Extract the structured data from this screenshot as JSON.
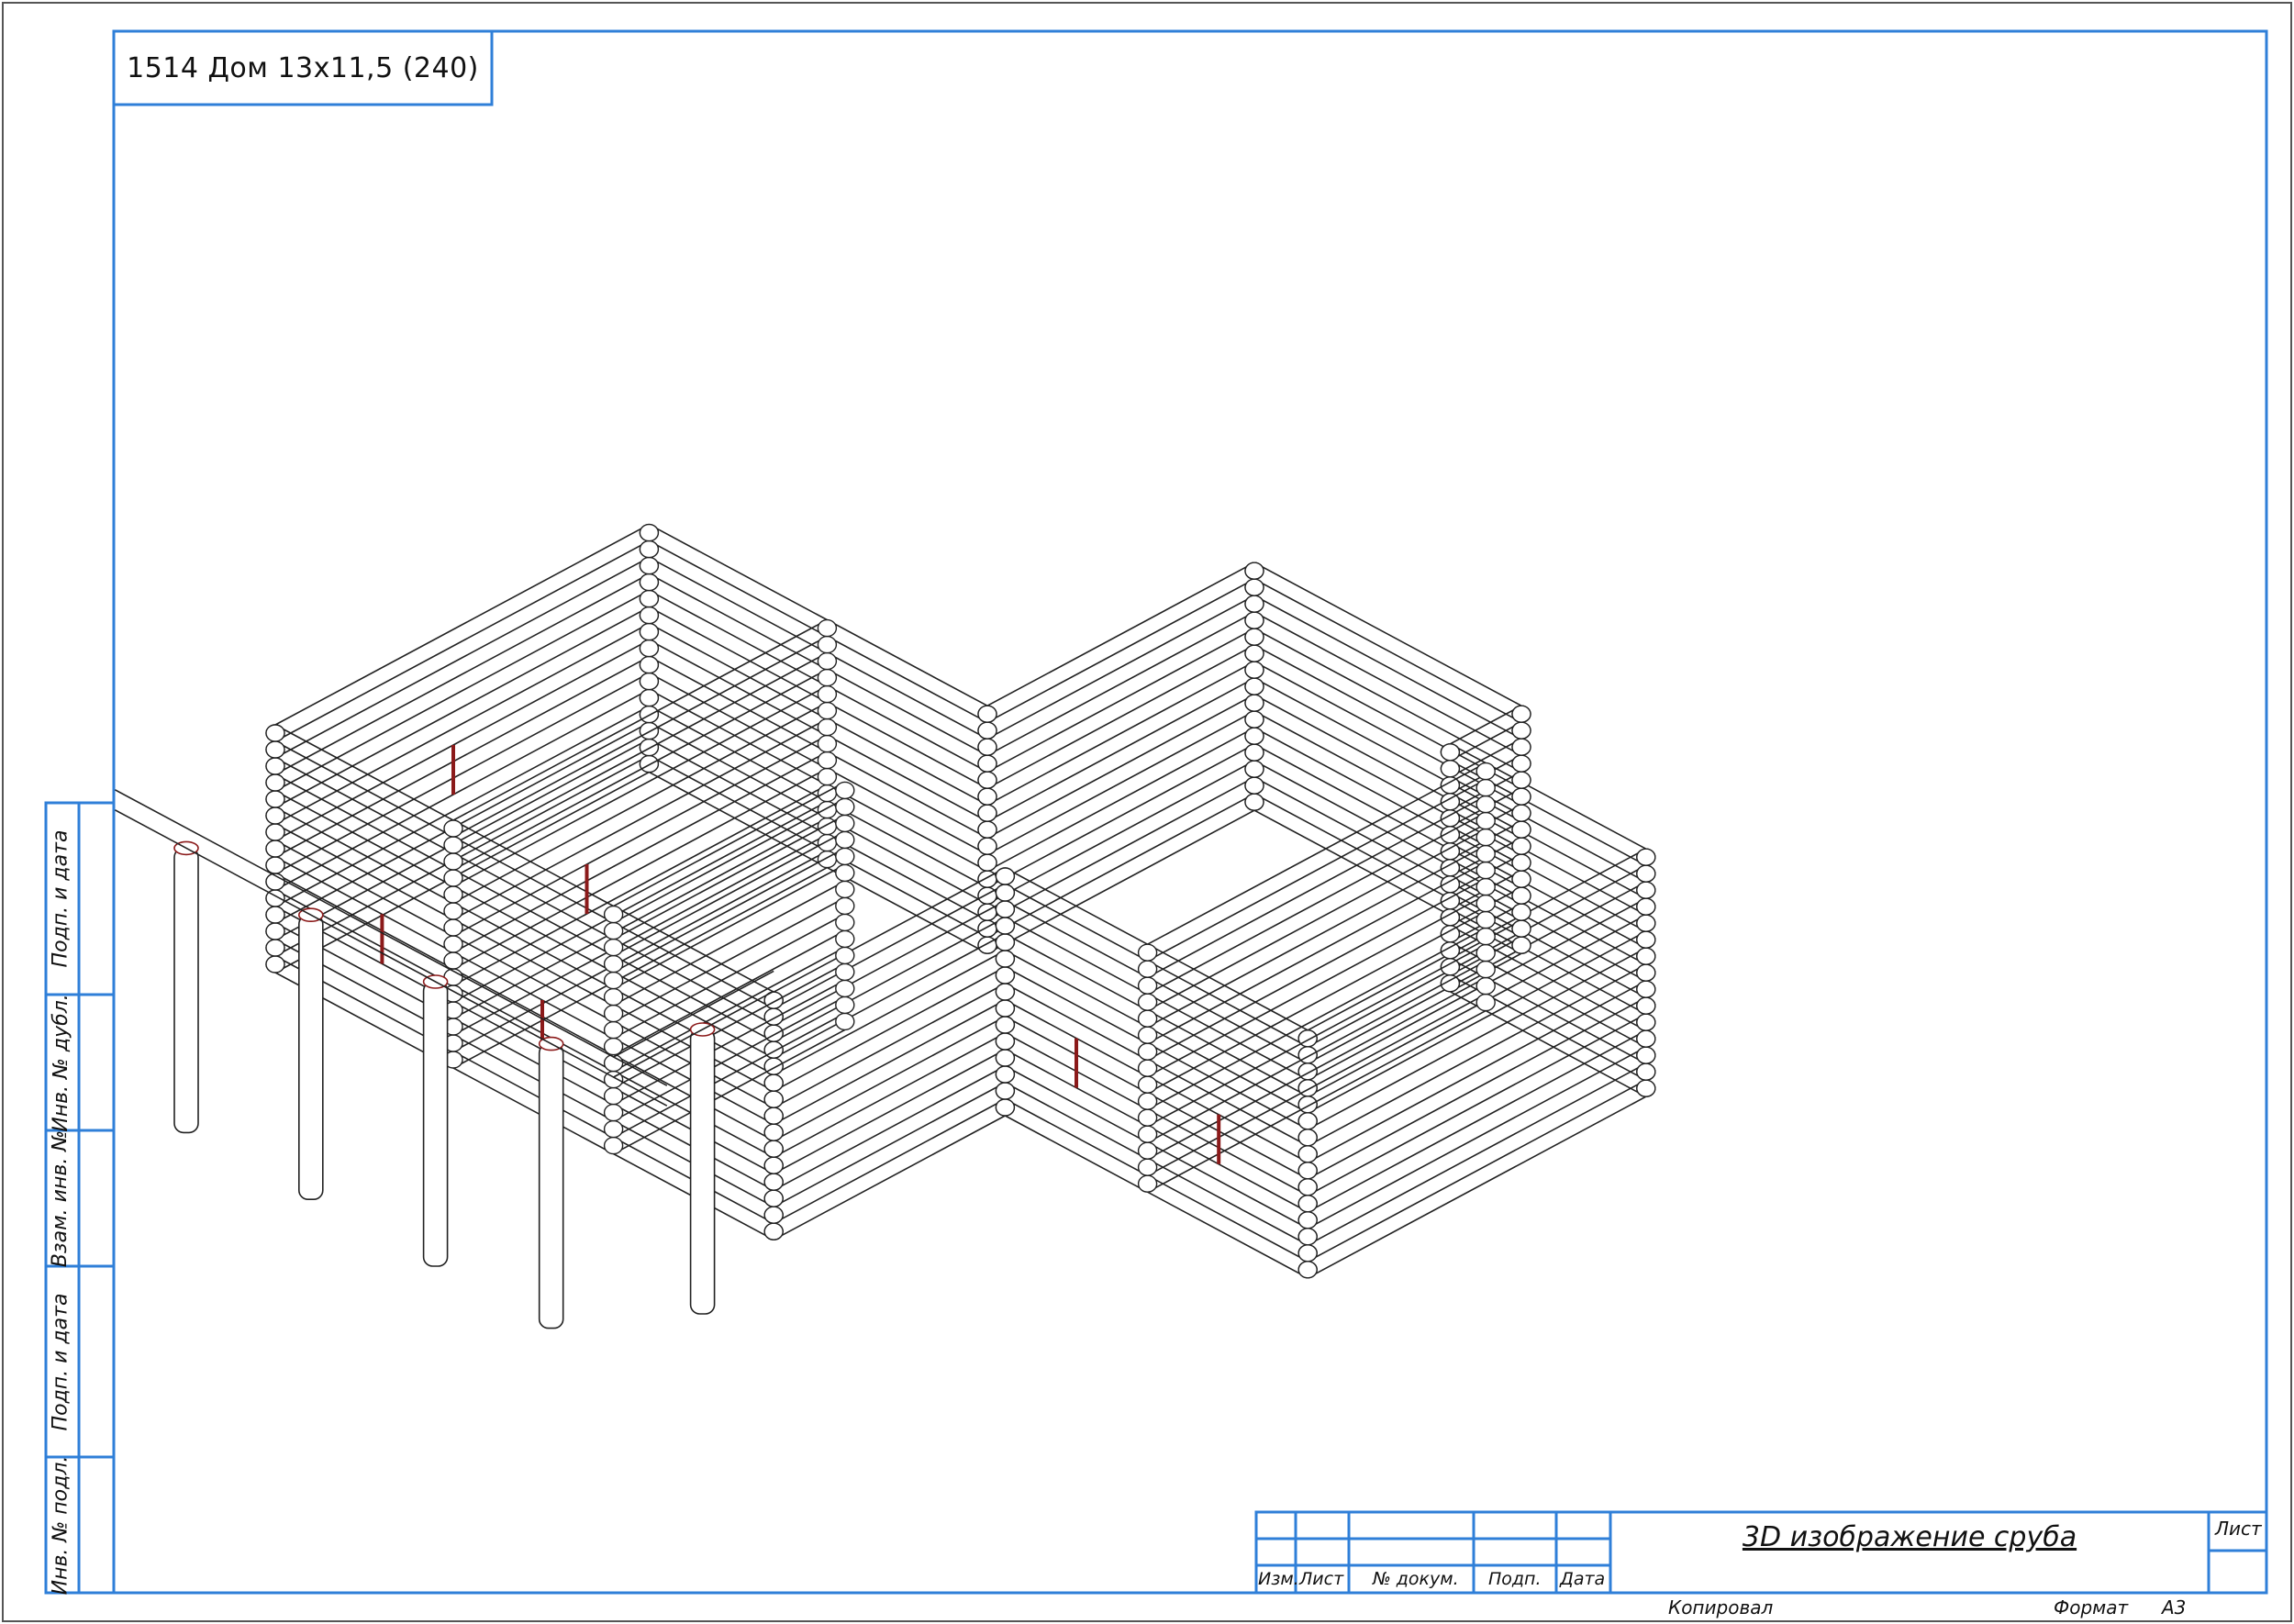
{
  "sheet_title": "1514 Дом 13x11,5 (240)",
  "drawing_title": "3D изображение сруба",
  "columns": {
    "izm": "Изм.",
    "list": "Лист",
    "doc": "№ докум.",
    "podp": "Подп.",
    "data": "Дата"
  },
  "list_label": "Лист",
  "copied_label": "Копировал",
  "format_label": "Формат",
  "format_value": "А3",
  "side_labels": [
    "Подп. и дата",
    "Инв. № дубл.",
    "Взам. инв. №",
    "Подп. и дата",
    "Инв. № подл."
  ],
  "colors": {
    "frame": "#2f7fd8",
    "line": "#222222",
    "accent": "#8b1a1a"
  }
}
